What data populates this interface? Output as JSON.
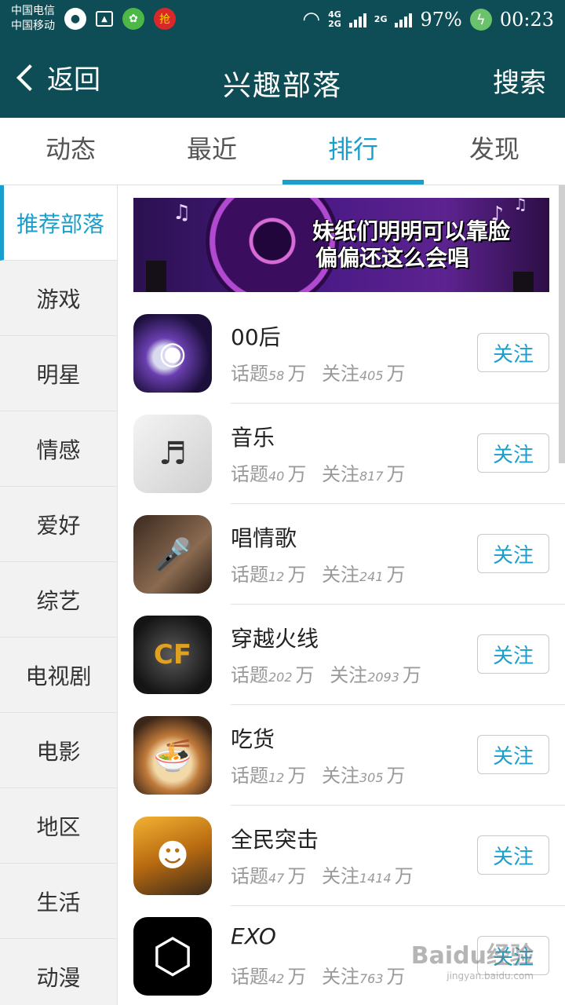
{
  "status_bar": {
    "carrier1": "中国电信",
    "carrier2": "中国移动",
    "net1": "4G",
    "net1b": "2G",
    "net2": "2G",
    "battery": "97%",
    "time": "00:23"
  },
  "header": {
    "back_label": "返回",
    "title": "兴趣部落",
    "search_label": "搜索"
  },
  "tabs": [
    {
      "label": "动态"
    },
    {
      "label": "最近"
    },
    {
      "label": "排行"
    },
    {
      "label": "发现"
    }
  ],
  "active_tab": "排行",
  "sidebar": [
    {
      "label": "推荐部落"
    },
    {
      "label": "游戏"
    },
    {
      "label": "明星"
    },
    {
      "label": "情感"
    },
    {
      "label": "爱好"
    },
    {
      "label": "综艺"
    },
    {
      "label": "电视剧"
    },
    {
      "label": "电影"
    },
    {
      "label": "地区"
    },
    {
      "label": "生活"
    },
    {
      "label": "动漫"
    }
  ],
  "banner": {
    "line1": "妹纸们明明可以靠脸",
    "line2": "偏偏还这么会唱"
  },
  "topic_label": "话题",
  "follow_label": "关注",
  "unit": "万",
  "tribes": [
    {
      "name": "00后",
      "topics": "58",
      "followers": "405"
    },
    {
      "name": "音乐",
      "topics": "40",
      "followers": "817"
    },
    {
      "name": "唱情歌",
      "topics": "12",
      "followers": "241"
    },
    {
      "name": "穿越火线",
      "topics": "202",
      "followers": "2093"
    },
    {
      "name": "吃货",
      "topics": "12",
      "followers": "305"
    },
    {
      "name": "全民突击",
      "topics": "47",
      "followers": "1414"
    },
    {
      "name": "EXO",
      "topics": "42",
      "followers": "763"
    }
  ],
  "colors": {
    "header_bg": "#0e4d55",
    "accent": "#1a9fcc"
  },
  "watermark": {
    "text": "Baidu经验",
    "url": "jingyan.baidu.com"
  }
}
